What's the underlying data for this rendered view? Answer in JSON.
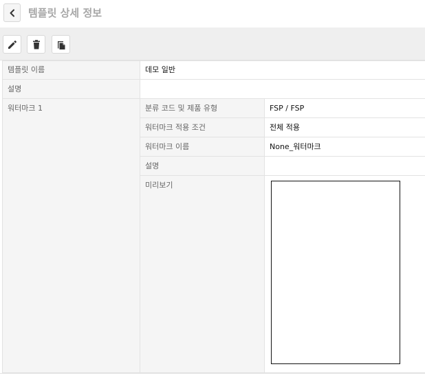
{
  "header": {
    "title": "템플릿 상세 정보"
  },
  "toolbar": {
    "icons": [
      "pencil-icon",
      "trash-icon",
      "copy-icon"
    ]
  },
  "template": {
    "name_label": "템플릿 이름",
    "name_value": "데모 일반",
    "desc_label": "설명",
    "desc_value": ""
  },
  "watermark": {
    "section_label": "워터마크 1",
    "rows": [
      {
        "label": "분류 코드 및 제품 유형",
        "value": "FSP / FSP"
      },
      {
        "label": "워터마크 적용 조건",
        "value": "전체 적용"
      },
      {
        "label": "워터마크 이름",
        "value": "None_워터마크"
      },
      {
        "label": "설명",
        "value": ""
      }
    ],
    "preview_label": "미리보기"
  }
}
